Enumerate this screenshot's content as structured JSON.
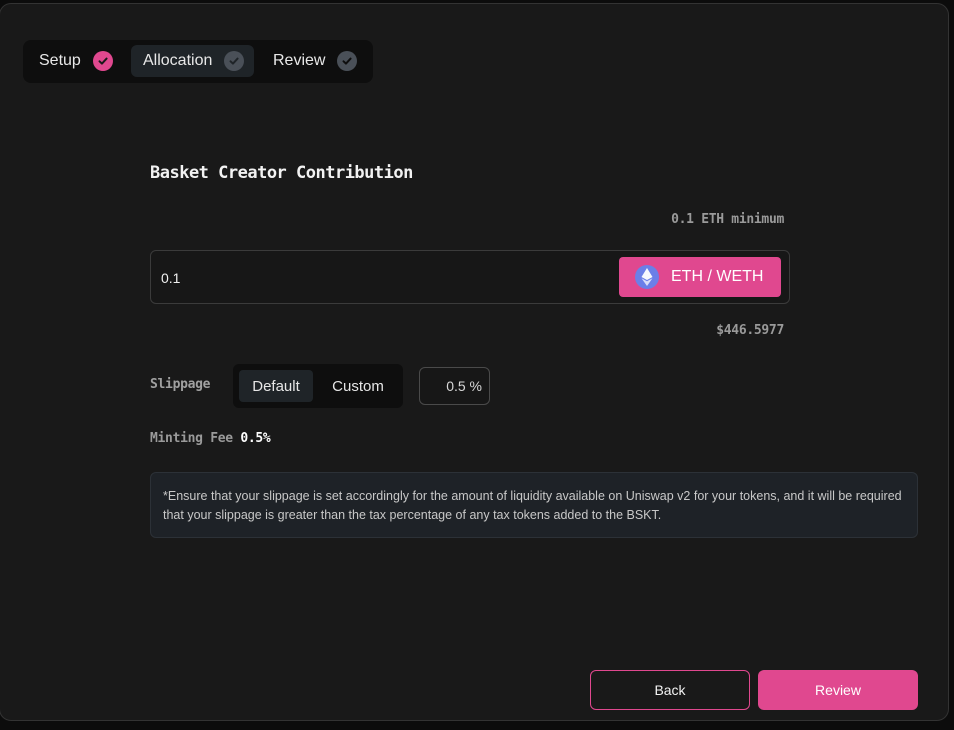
{
  "stepper": {
    "steps": [
      {
        "label": "Setup",
        "status": "complete",
        "icon": "check-icon"
      },
      {
        "label": "Allocation",
        "status": "current",
        "icon": "check-icon"
      },
      {
        "label": "Review",
        "status": "pending",
        "icon": "check-icon"
      }
    ]
  },
  "contribution": {
    "title": "Basket Creator Contribution",
    "minimum_text": "0.1 ETH minimum",
    "amount_value": "0.1",
    "token_label": "ETH / WETH",
    "token_icon": "ethereum-icon",
    "usd_value": "$446.5977"
  },
  "slippage": {
    "label": "Slippage",
    "options": [
      "Default",
      "Custom"
    ],
    "selected": "Default",
    "value": "0.5 %"
  },
  "minting_fee": {
    "label": "Minting Fee",
    "value": "0.5%"
  },
  "note": "*Ensure that your slippage is set accordingly for the amount of liquidity available on Uniswap v2 for your tokens, and it will be required that your slippage is greater than the tax percentage of any tax tokens added to the BSKT.",
  "actions": {
    "back_label": "Back",
    "review_label": "Review"
  },
  "colors": {
    "accent": "#e0488f",
    "background": "#191919",
    "pending_check": "#4a5058"
  }
}
